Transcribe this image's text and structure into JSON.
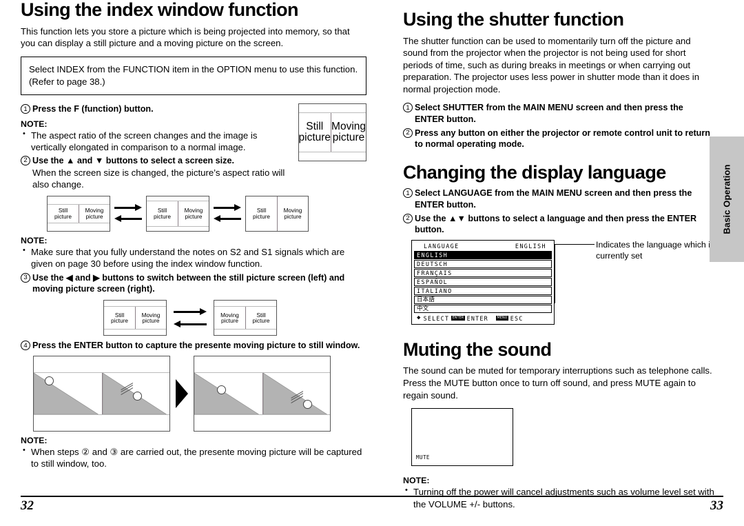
{
  "left_page": {
    "title": "Using the index window function",
    "intro": "This function lets you store a picture which is being projected into memory, so that you can display a still picture and a moving picture on the screen.",
    "callout": "Select INDEX from the FUNCTION item in the OPTION menu to use this function. (Refer to page 38.)",
    "step1": {
      "num": "1",
      "text": "Press the F (function) button."
    },
    "note1_heading": "NOTE:",
    "note1_item": "The aspect ratio of the screen changes and the image is vertically elongated in comparison to a normal image.",
    "step2": {
      "num": "2",
      "text": "Use the ▲ and ▼ buttons to select a screen size."
    },
    "step2_sub": "When the screen size is changed, the picture’s aspect ratio will also change.",
    "note2_heading": "NOTE:",
    "note2_item": "Make sure that you fully understand the notes on S2 and S1 signals which are given on page 30 before using the index window function.",
    "step3": {
      "num": "3",
      "text": "Use the ◀ and ▶ buttons to switch between the still picture screen (left) and moving picture screen (right)."
    },
    "step4": {
      "num": "4",
      "text": "Press the ENTER button to capture the presente moving picture to still window."
    },
    "note3_heading": "NOTE:",
    "note3_item": "When steps ② and ③ are carried out, the presente moving picture will be captured to still window, too.",
    "screen_labels": {
      "still_l1": "Still",
      "still_l2": "picture",
      "moving_l1": "Moving",
      "moving_l2": "picture"
    },
    "page_number": "32"
  },
  "right_page": {
    "shutter": {
      "title": "Using the shutter function",
      "intro": "The shutter function can be used to momentarily turn off the picture and sound from the projector when the projector is not being used for short periods of time, such as during breaks in meetings or when carrying out preparation. The projector uses less power in shutter mode than it does in normal projection mode.",
      "step1": {
        "num": "1",
        "text": "Select SHUTTER from the MAIN MENU screen and then press the ENTER button."
      },
      "step2": {
        "num": "2",
        "text": "Press any button on either the projector or remote control unit to return to normal operating mode."
      }
    },
    "language": {
      "title": "Changing the display language",
      "step1": {
        "num": "1",
        "text": "Select LANGUAGE from the MAIN MENU screen and then press the ENTER button."
      },
      "step2": {
        "num": "2",
        "text": "Use the ▲▼ buttons to select a language and then press the ENTER button."
      },
      "osd": {
        "header_left": "LANGUAGE",
        "header_right": "ENGLISH",
        "items": [
          {
            "label": "ENGLISH",
            "selected": true
          },
          {
            "label": "DEUTSCH",
            "selected": false
          },
          {
            "label": "FRANÇAIS",
            "selected": false
          },
          {
            "label": "ESPAÑOL",
            "selected": false
          },
          {
            "label": "ITALIANO",
            "selected": false
          },
          {
            "label": "日本語",
            "selected": false
          },
          {
            "label": "中文",
            "selected": false
          }
        ],
        "footer": {
          "updown_icon": "up-down-arrow-icon",
          "select_label": "SELECT",
          "enter_key": "ENTER",
          "enter_label": "ENTER",
          "menu_key": "MENU",
          "esc_label": "ESC"
        }
      },
      "annotation": "Indicates the language which is currently set"
    },
    "mute": {
      "title": "Muting the sound",
      "intro": "The sound can be muted for temporary interruptions such as telephone calls. Press the MUTE button once to turn off sound, and press MUTE again to regain sound.",
      "osd_label": "MUTE",
      "note_heading": "NOTE:",
      "note_item": "Turning off the power will cancel adjustments such as volume level set with the VOLUME +/- buttons."
    },
    "side_tab": "Basic Operation",
    "page_number": "33"
  }
}
